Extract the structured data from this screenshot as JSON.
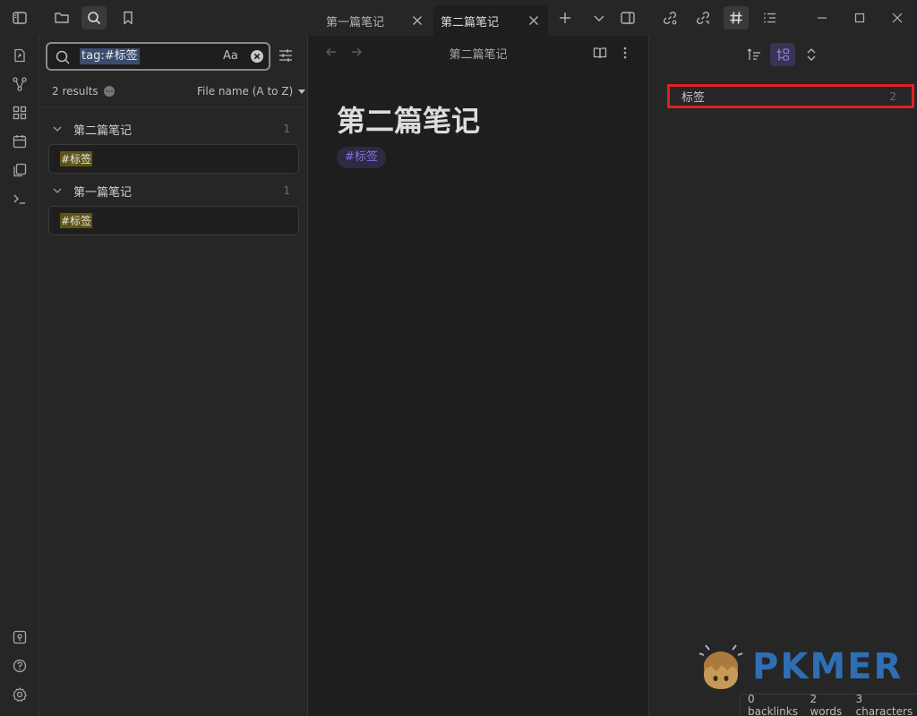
{
  "tabs": [
    {
      "label": "第一篇笔记",
      "active": false
    },
    {
      "label": "第二篇笔记",
      "active": true
    }
  ],
  "search": {
    "query": "tag:#标签",
    "match_case_label": "Aa",
    "results_count": "2 results",
    "sort_label": "File name (A to Z)",
    "results": [
      {
        "file": "第二篇笔记",
        "count": "1",
        "match": "#标签"
      },
      {
        "file": "第一篇笔记",
        "count": "1",
        "match": "#标签"
      }
    ]
  },
  "editor": {
    "view_title": "第二篇笔记",
    "heading": "第二篇笔记",
    "tag": "#标签"
  },
  "tag_pane": {
    "tags": [
      {
        "name": "标签",
        "count": "2"
      }
    ]
  },
  "watermark": "PKMER",
  "status": {
    "backlinks": "0 backlinks",
    "words": "2 words",
    "characters": "3 characters"
  },
  "colors": {
    "accent": "#8a6fe0",
    "highlight_box": "#e02020",
    "match_highlight": "#5e5314"
  }
}
